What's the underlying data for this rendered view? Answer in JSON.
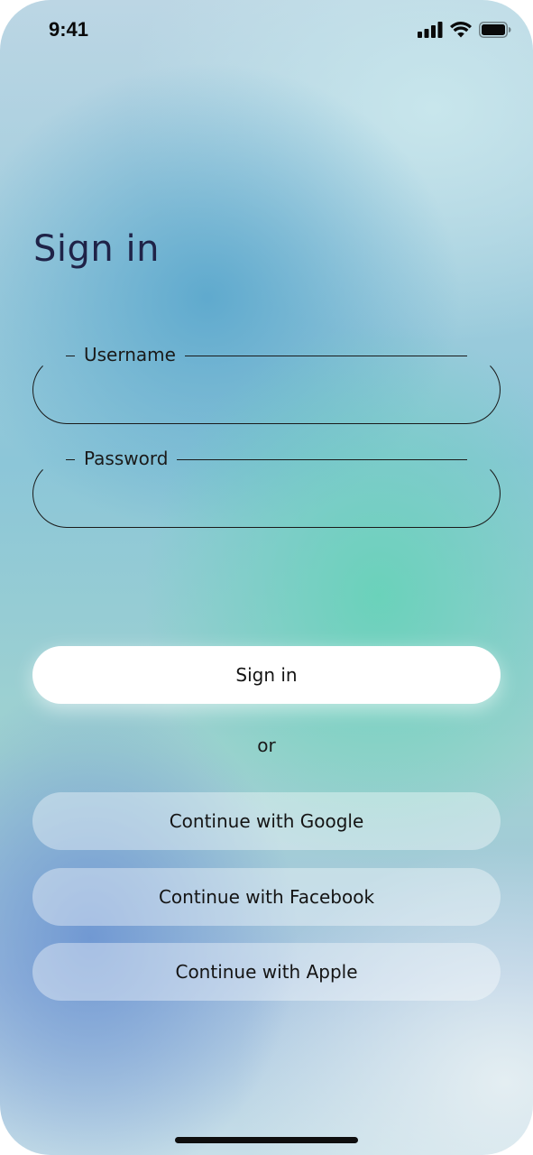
{
  "status_bar": {
    "time": "9:41",
    "signal_icon": "cellular-signal-icon",
    "wifi_icon": "wifi-icon",
    "battery_icon": "battery-icon"
  },
  "header": {
    "title": "Sign in"
  },
  "form": {
    "username": {
      "label": "Username",
      "value": ""
    },
    "password": {
      "label": "Password",
      "value": ""
    },
    "submit_label": "Sign in",
    "divider": "or"
  },
  "social": {
    "google_label": "Continue with Google",
    "facebook_label": "Continue with Facebook",
    "apple_label": "Continue with Apple"
  },
  "colors": {
    "title": "#1f2348",
    "field_border": "#1a1a1a",
    "primary_button": "#ffffff"
  }
}
